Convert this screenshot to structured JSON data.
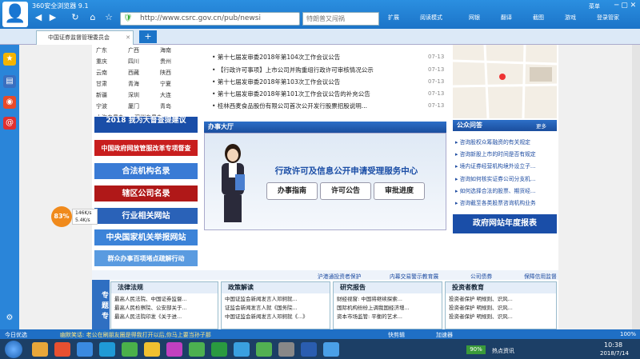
{
  "browser": {
    "title": "360安全浏览器 9.1",
    "url": "http://www.csrc.gov.cn/pub/newsi",
    "search_placeholder": "特朗普又闯祸",
    "tab_title": "中国证券监督管理委员会",
    "new_tab": "+",
    "toolbar": [
      "扩展",
      "阅读模式",
      "网银",
      "翻译",
      "截图",
      "游戏"
    ],
    "menu": "菜单",
    "login": "登录管家"
  },
  "cities": [
    [
      "广东",
      "广西",
      "海南"
    ],
    [
      "重庆",
      "四川",
      "贵州"
    ],
    [
      "云南",
      "西藏",
      "陕西"
    ],
    [
      "甘肃",
      "青海",
      "宁夏"
    ],
    [
      "新疆",
      "深圳",
      "大连"
    ],
    [
      "宁波",
      "厦门",
      "青岛"
    ],
    [
      "上海专员办",
      "深圳专员办",
      ""
    ]
  ],
  "banners": [
    "2018 我为大督查提建议",
    "中国政府网放管服改革专项督查",
    "合法机构名录",
    "辖区公司名录",
    "行业相关网站",
    "中央国家机关举报网站",
    "群众办事百项堵点疏解行动"
  ],
  "news": [
    {
      "title": "第十七届发审委2018年第104次工作会议公告",
      "date": "07-13"
    },
    {
      "title": "【行政许可事项】上市公司并购重组行政许可审核情况公示",
      "date": "07-13"
    },
    {
      "title": "第十七届发审委2018年第103次工作会议公告",
      "date": "07-13"
    },
    {
      "title": "第十七届发审委2018年第101次工作会议公告的补充公告",
      "date": "07-13"
    },
    {
      "title": "桂林西麦食品股份有限公司首次公开发行股票招股说明...",
      "date": "07-13"
    }
  ],
  "service": {
    "header": "办事大厅",
    "title": "行政许可及信息公开申请受理服务中心",
    "buttons": [
      "办事指南",
      "许可公告",
      "审批进度"
    ]
  },
  "qa": {
    "title": "公众问答",
    "more": "更多",
    "items": [
      "咨询股权众筹融资的有关规定",
      "咨询新股上市的时间是否有规定",
      "境内证券经营机构境外设立子...",
      "咨询如何核实证券公司分支机...",
      "如何选择合法的股票、期货经...",
      "咨询截至各类股票咨询机构业务"
    ],
    "report": "政府网站年度报表"
  },
  "links": [
    "沪港通投资者保护",
    "内幕交易警示教育展",
    "公司债券",
    "保障信用监督"
  ],
  "topics": {
    "label": "专题专",
    "cols": [
      {
        "title": "法律法规",
        "items": [
          "最高人民法院、中国证券监督...",
          "最高人民检察院、公安部关于...",
          "最高人民法院印发《关于进..."
        ]
      },
      {
        "title": "政策解读",
        "items": [
          "中国证监会新闻发言人邓舸就...",
          "证监会新闻发言人就《国务院...",
          "中国证监会新闻发言人邓舸就《...》"
        ]
      },
      {
        "title": "研究报告",
        "items": [
          "财经视窗: 中国将继续探索...",
          "国际机构纷纷上调我国经济增...",
          "资本市场监管: 平衡的艺术..."
        ]
      },
      {
        "title": "投资者教育",
        "items": [
          "投资者保护 明规则、识风...",
          "投资者保护 明规则、识风...",
          "投资者保护 明规则、识风..."
        ]
      }
    ],
    "more": "更多"
  },
  "float": {
    "percent": "83%",
    "up": "146K/s",
    "down": "5.4K/s"
  },
  "status": {
    "left": "今日优选",
    "ticker": "幽默笑话: 老公在刷朋友圈是得我打开以后,你马上要当孙子那",
    "download": "快剪辑",
    "speed": "加速器",
    "zoom": "100%"
  },
  "taskbar": {
    "battery": "90%",
    "net": "热点资讯",
    "time": "10:38",
    "date": "2018/7/14"
  }
}
